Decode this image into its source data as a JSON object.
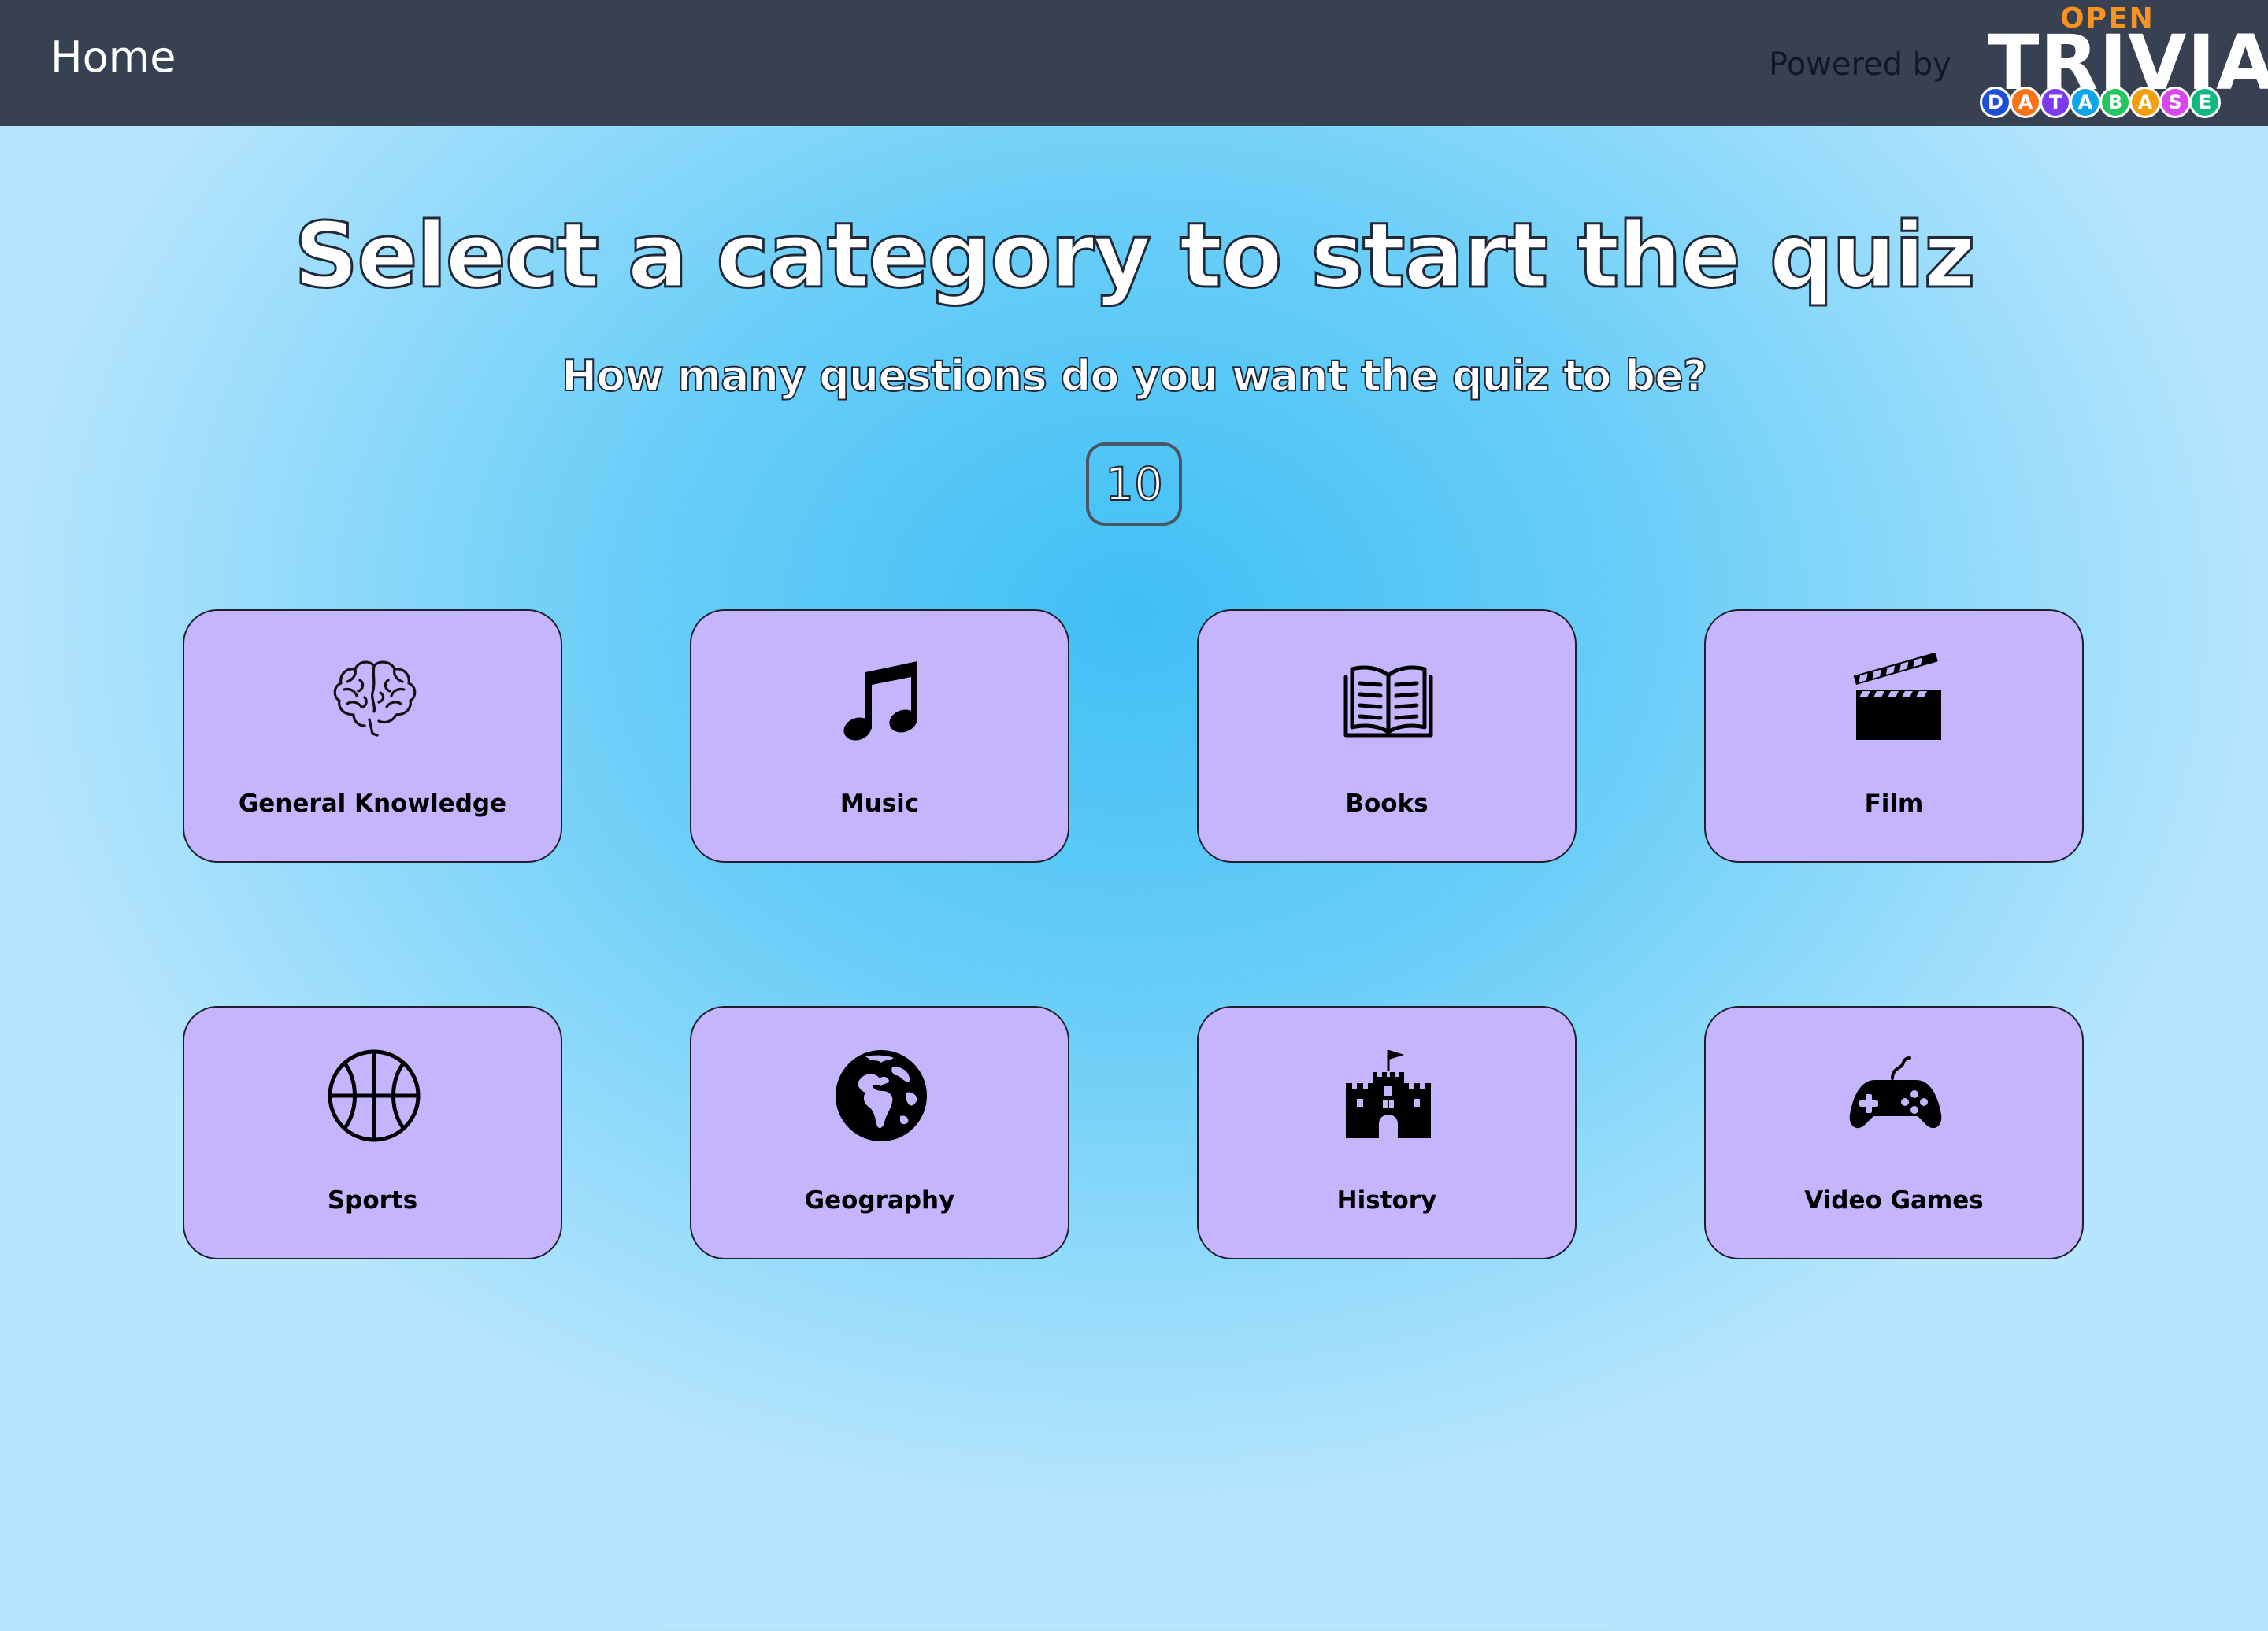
{
  "nav": {
    "home_label": "Home",
    "powered_by": "Powered by",
    "logo": {
      "top_word": "OPEN",
      "main_word": "TRIVIA",
      "letters": [
        "D",
        "A",
        "T",
        "A",
        "B",
        "A",
        "S",
        "E"
      ],
      "letter_colors": [
        "#1d4ed8",
        "#f97316",
        "#7c3aed",
        "#0ea5e9",
        "#22c55e",
        "#f59e0b",
        "#d946ef",
        "#10b981"
      ]
    }
  },
  "page": {
    "title": "Select a category to start the quiz",
    "question_prompt": "How many questions do you want the quiz to be?",
    "question_count": "10"
  },
  "categories": [
    {
      "label": "General Knowledge",
      "icon": "brain-icon"
    },
    {
      "label": "Music",
      "icon": "music-note-icon"
    },
    {
      "label": "Books",
      "icon": "open-book-icon"
    },
    {
      "label": "Film",
      "icon": "clapperboard-icon"
    },
    {
      "label": "Sports",
      "icon": "basketball-icon"
    },
    {
      "label": "Geography",
      "icon": "globe-icon"
    },
    {
      "label": "History",
      "icon": "castle-icon"
    },
    {
      "label": "Video Games",
      "icon": "gamepad-icon"
    }
  ],
  "colors": {
    "navbar": "#374151",
    "card": "#c4b5fd",
    "background_center": "#40bff5",
    "logo_open": "#f7931e"
  }
}
